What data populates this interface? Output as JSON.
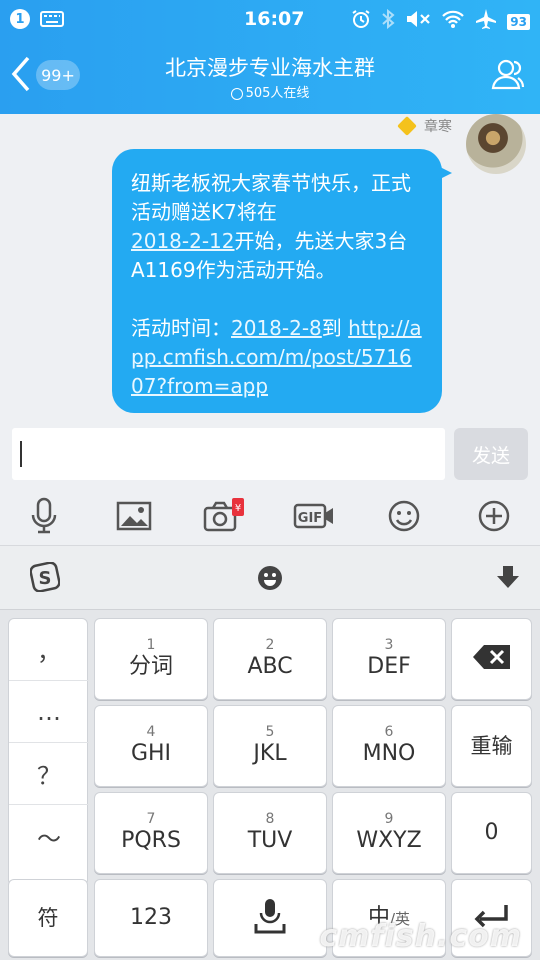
{
  "status_bar": {
    "notification_count": "1",
    "time": "16:07",
    "battery": "93",
    "icons": [
      "keyboard-icon",
      "alarm-icon",
      "bluetooth-icon",
      "mute-icon",
      "wifi-icon",
      "airplane-icon",
      "battery-icon"
    ]
  },
  "header": {
    "back_icon": "back-chevron-icon",
    "unread_badge": "99+",
    "title": "北京漫步专业海水主群",
    "online_count": "505人在线",
    "profile_icon": "group-members-icon"
  },
  "chat": {
    "sender_name": "章寒",
    "message": {
      "line1": "纽斯老板祝大家春节快乐，正式活动赠送K7将在",
      "date1": "2018-2-12",
      "line2": "开始，先送大家3台A1169作为活动开始。",
      "line3": "活动时间：",
      "date2": "2018-2-8",
      "line4": "到",
      "link": "http://app.cmfish.com/m/post/571607?from=app"
    }
  },
  "input": {
    "value": "",
    "send_label": "发送"
  },
  "toolbar": {
    "items": [
      "microphone-icon",
      "image-icon",
      "camera-redpacket-icon",
      "gif-icon",
      "emoji-icon",
      "plus-icon"
    ]
  },
  "keyboard": {
    "top_icons": [
      "sogou-logo-icon",
      "emoji-icon",
      "hide-keyboard-icon"
    ],
    "punctuation": [
      "，",
      "…",
      "？",
      "～"
    ],
    "keys": [
      {
        "num": "1",
        "label": "分词"
      },
      {
        "num": "2",
        "label": "ABC"
      },
      {
        "num": "3",
        "label": "DEF"
      },
      {
        "num": "4",
        "label": "GHI"
      },
      {
        "num": "5",
        "label": "JKL"
      },
      {
        "num": "6",
        "label": "MNO"
      },
      {
        "num": "7",
        "label": "PQRS"
      },
      {
        "num": "8",
        "label": "TUV"
      },
      {
        "num": "9",
        "label": "WXYZ"
      }
    ],
    "backspace_icon": "backspace-icon",
    "retype_label": "重输",
    "zero_label": "0",
    "symbol_label": "符",
    "numbers_label": "123",
    "space_icon": "voice-space-icon",
    "lang_main": "中",
    "lang_alt": "/英",
    "enter_icon": "enter-icon"
  },
  "watermark": "cmfish.com"
}
